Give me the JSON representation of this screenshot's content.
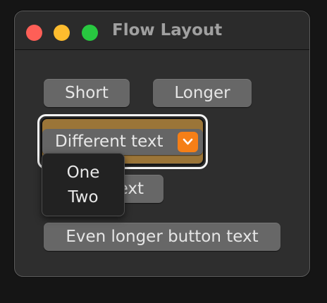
{
  "window": {
    "title": "Flow Layout"
  },
  "buttons": {
    "short": "Short",
    "longer": "Longer",
    "partial": "ext",
    "even_longer": "Even longer button text"
  },
  "picker": {
    "selected": "Different text",
    "chevron_icon": "chevron-down-icon",
    "accent_color": "#f57f17"
  },
  "menu": {
    "items": [
      "One",
      "Two"
    ]
  },
  "colors": {
    "close": "#fe5f57",
    "minimize": "#febc2e",
    "zoom": "#28c840"
  }
}
